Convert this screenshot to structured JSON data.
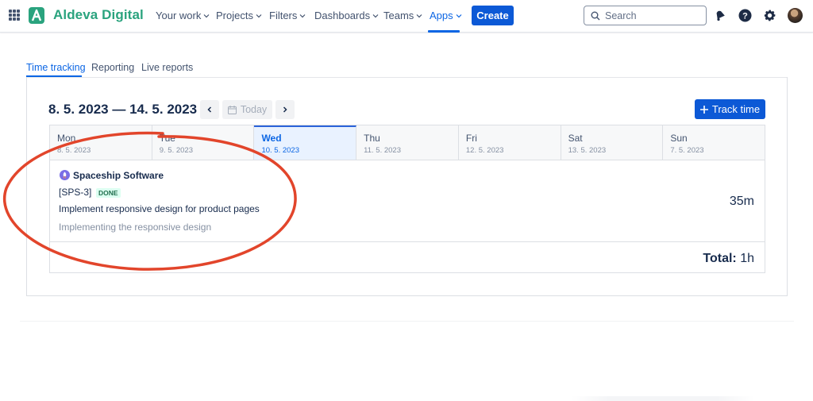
{
  "app": {
    "name": "Aldeva Digital",
    "brand_color": "#2aa37e",
    "accent_color": "#0c66e4"
  },
  "nav": {
    "items": [
      {
        "label": "Your work",
        "icon": "chevron-down-icon"
      },
      {
        "label": "Projects",
        "icon": "chevron-down-icon"
      },
      {
        "label": "Filters",
        "icon": "chevron-down-icon"
      },
      {
        "label": "Dashboards",
        "icon": "chevron-down-icon"
      },
      {
        "label": "Teams",
        "icon": "chevron-down-icon"
      },
      {
        "label": "Apps",
        "icon": "chevron-down-icon",
        "active": true
      }
    ],
    "create_label": "Create",
    "search_placeholder": "Search",
    "icons": [
      "notifications-icon",
      "help-icon",
      "settings-icon",
      "avatar"
    ]
  },
  "tabs": [
    {
      "label": "Time tracking",
      "active": true
    },
    {
      "label": "Reporting"
    },
    {
      "label": "Live reports"
    }
  ],
  "toolbar": {
    "date_range": "8. 5. 2023 — 14. 5. 2023",
    "today_label": "Today",
    "track_time_label": "Track time"
  },
  "week": {
    "days": [
      {
        "name": "Mon",
        "date": "8. 5. 2023"
      },
      {
        "name": "Tue",
        "date": "9. 5. 2023"
      },
      {
        "name": "Wed",
        "date": "10. 5. 2023",
        "current": true
      },
      {
        "name": "Thu",
        "date": "11. 5. 2023"
      },
      {
        "name": "Fri",
        "date": "12. 5. 2023"
      },
      {
        "name": "Sat",
        "date": "13. 5. 2023"
      },
      {
        "name": "Sun",
        "date": "7. 5. 2023"
      }
    ]
  },
  "entry": {
    "project": "Spaceship Software",
    "issue_key": "[SPS-3]",
    "status": "DONE",
    "status_color": "#216e4e",
    "summary": "Implement responsive design for product pages",
    "description": "Implementing the responsive design",
    "duration": "35m"
  },
  "total": {
    "label": "Total:",
    "value": "1h"
  },
  "annotation_color": "#e2452b"
}
